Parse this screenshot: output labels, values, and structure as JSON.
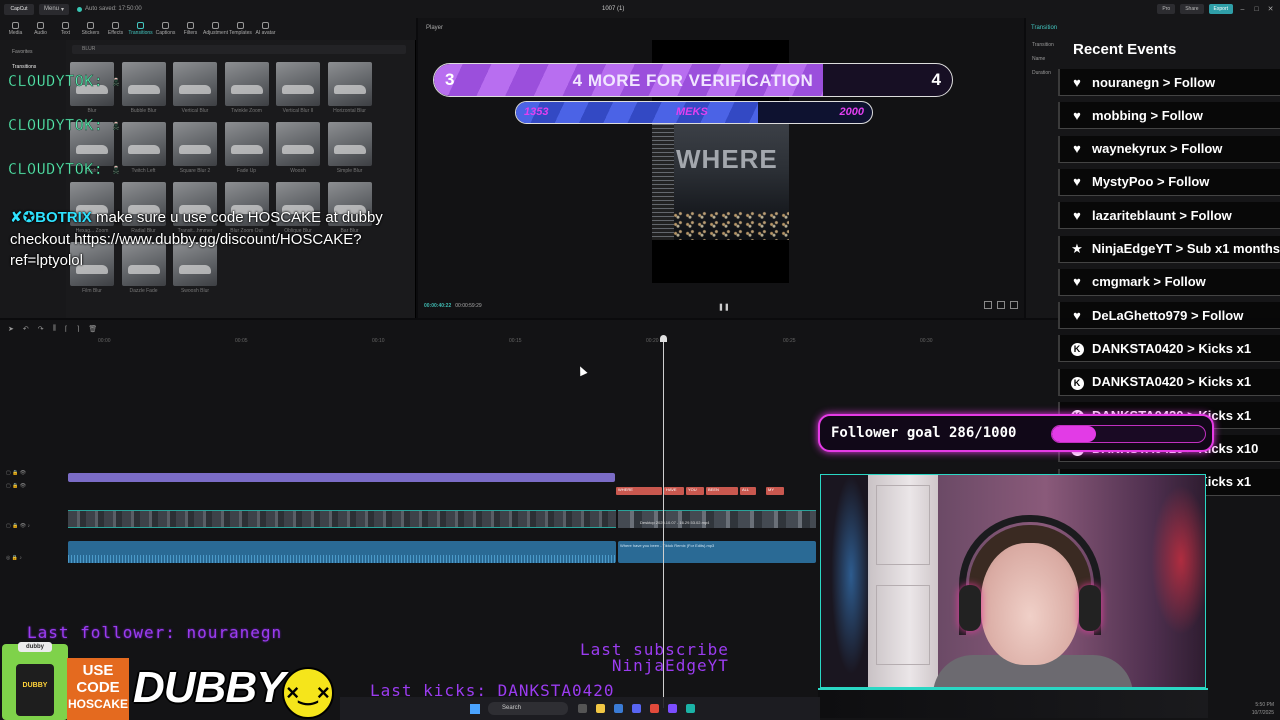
{
  "editor": {
    "menu_label": "Menu",
    "autosave": "Auto saved: 17:50:00",
    "doc_title": "1007 (1)",
    "pro_label": "Pro",
    "share_label": "Share",
    "export_label": "Export",
    "toolbar": [
      "Media",
      "Audio",
      "Text",
      "Stickers",
      "Effects",
      "Transitions",
      "Captions",
      "Filters",
      "Adjustment",
      "Templates",
      "AI avatar"
    ],
    "active_tool": "Transitions",
    "sidebar": [
      "Favorites",
      "Transitions"
    ],
    "search_placeholder": "BLUR",
    "thumb_labels": [
      "Blur",
      "Bubble Blur",
      "Vertical Blur",
      "Twinkle Zoom",
      "Vertical Blur II",
      "Horizontal Blur",
      "Right",
      "Twitch Left",
      "Square Blur 2",
      "Fade Up",
      "Woosh",
      "Simple Blur",
      "Hexag... Zoom",
      "Radial Blur",
      "Transit...hmmer",
      "Blur Zoom Out",
      "Oblique Blur",
      "Bar Blur",
      "Film Blur",
      "Dazzle Fade",
      "Swoosh Blur"
    ],
    "player_title": "Player",
    "timecode_current": "00:00:40:22",
    "timecode_total": "00:00:59:29",
    "details_title": "Transition",
    "details_rows": [
      "Transition",
      "Name",
      "Duration"
    ],
    "ruler_ticks": [
      "00:00",
      "00:05",
      "00:10",
      "00:15",
      "00:20",
      "00:25",
      "00:30"
    ],
    "red_clips": [
      "WHERE",
      "HAVE",
      "YOU",
      "BEEN",
      "ALL",
      "MY"
    ],
    "video_clip2": "Desktop 2025.10.07 - 16.29.53.02.mp4",
    "audio_clip2": "Where have you been - Tiktok Remix (For Edits).mp3",
    "video_overlay_text": "WHERE"
  },
  "chat": {
    "user_lines": [
      "CLOUDYTOK:",
      "CLOUDYTOK:",
      "CLOUDYTOK:"
    ],
    "bot_name": "BOTRIX",
    "bot_message": "make sure u use code HOSCAKE at dubby checkout https://www.dubby.gg/discount/HOSCAKE?ref=lptyolol"
  },
  "verification": {
    "left": "3",
    "message": "4 MORE FOR VERIFICATION",
    "right": "4",
    "progress": 0.75
  },
  "sub_goal": {
    "left": "1353",
    "mid": "MEKS",
    "right": "2000",
    "progress": 0.68
  },
  "recent_events": {
    "title": "Recent Events",
    "items": [
      {
        "icon": "heart",
        "text": "nouranegn > Follow"
      },
      {
        "icon": "heart",
        "text": "mobbing > Follow"
      },
      {
        "icon": "heart",
        "text": "waynekyrux > Follow"
      },
      {
        "icon": "heart",
        "text": "MystyPoo > Follow"
      },
      {
        "icon": "heart",
        "text": "lazariteblaunt > Follow"
      },
      {
        "icon": "star",
        "text": "NinjaEdgeYT > Sub x1 months"
      },
      {
        "icon": "heart",
        "text": "cmgmark > Follow"
      },
      {
        "icon": "heart",
        "text": "DeLaGhetto979 > Follow"
      },
      {
        "icon": "kick",
        "text": "DANKSTA0420 > Kicks x1"
      },
      {
        "icon": "kick",
        "text": "DANKSTA0420 > Kicks x1"
      },
      {
        "icon": "kick",
        "text": "DANKSTA0420 > Kicks x1"
      },
      {
        "icon": "kick",
        "text": "DANKSTA0420 > Kicks x10"
      },
      {
        "icon": "kick",
        "text": "DANKSTA0420 > Kicks x1"
      }
    ]
  },
  "follower_goal": {
    "label": "Follower goal 286/1000",
    "current": 286,
    "target": 1000,
    "colors": {
      "accent": "#e23be6"
    }
  },
  "last_follower": "Last follower: nouranegn",
  "last_subscriber": [
    "Last subscribe",
    "NinjaEdgeYT"
  ],
  "last_kicks": "Last kicks: DANKSTA0420",
  "sponsor": {
    "tub_lid": "dubby",
    "tub_label": "DUBBY",
    "code_text": [
      "USE",
      "CODE",
      "HOSCAKE"
    ],
    "brand": "DUBBY"
  },
  "taskbar": {
    "search_label": "Search",
    "clock": "5:50 PM",
    "date": "10/7/2025"
  }
}
